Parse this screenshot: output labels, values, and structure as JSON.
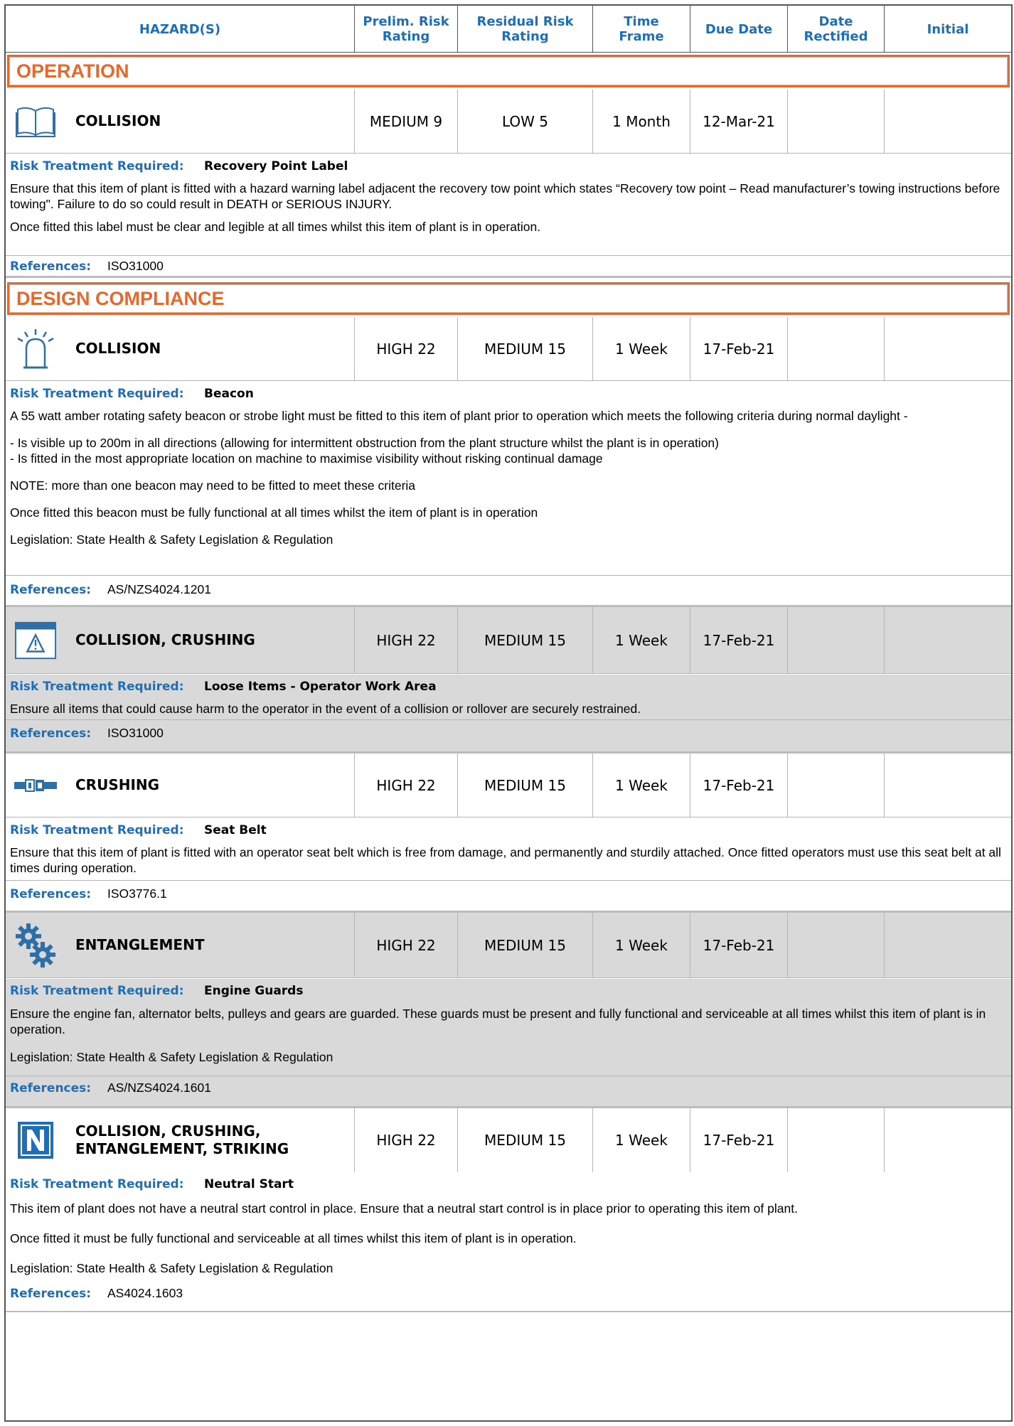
{
  "header": {
    "hazards": "HAZARD(S)",
    "prelim": "Prelim. Risk\nRating",
    "residual": "Residual Risk\nRating",
    "timeframe": "Time\nFrame",
    "due": "Due Date",
    "rectified": "Date\nRectified",
    "initial": "Initial"
  },
  "labels": {
    "risk_treatment": "Risk Treatment Required:",
    "references": "References:"
  },
  "sections": [
    {
      "title": "OPERATION"
    },
    {
      "title": "DESIGN COMPLIANCE"
    }
  ],
  "items": [
    {
      "icon": "open-book-icon",
      "hazard": "COLLISION",
      "prelim": "MEDIUM 9",
      "residual": "LOW 5",
      "timeframe": "1 Month",
      "due": "12-Mar-21",
      "rectified": "",
      "initial": "",
      "treatment": "Recovery Point Label",
      "paragraphs": [
        "Ensure that this item of plant is fitted with a hazard warning label adjacent the recovery tow point which states “Recovery tow point – Read manufacturer’s towing instructions before towing\". Failure to do so could result in DEATH or SERIOUS INJURY.",
        "Once fitted this label must be clear and legible at all times whilst this item of plant is in operation."
      ],
      "references": "ISO31000"
    },
    {
      "icon": "beacon-icon",
      "hazard": "COLLISION",
      "prelim": "HIGH 22",
      "residual": "MEDIUM 15",
      "timeframe": "1 Week",
      "due": "17-Feb-21",
      "rectified": "",
      "initial": "",
      "treatment": "Beacon",
      "paragraphs": [
        "A 55 watt amber rotating safety beacon or strobe light must be fitted to this item of plant prior to operation which meets the following criteria during normal daylight -",
        "- Is visible up to 200m in all directions (allowing for intermittent obstruction from the plant structure whilst the plant is in operation)\n- Is fitted in the most appropriate location on machine to maximise visibility without risking continual damage",
        "NOTE: more than one beacon may need to be fitted to meet these criteria",
        "Once fitted this beacon must be fully functional at all times whilst the item of plant is in operation",
        "Legislation: State Health & Safety Legislation & Regulation"
      ],
      "references": "AS/NZS4024.1201"
    },
    {
      "icon": "warning-window-icon",
      "hazard": "COLLISION, CRUSHING",
      "prelim": "HIGH 22",
      "residual": "MEDIUM 15",
      "timeframe": "1 Week",
      "due": "17-Feb-21",
      "rectified": "",
      "initial": "",
      "treatment": "Loose Items - Operator Work Area",
      "paragraphs": [
        "Ensure all items that could cause harm to the operator in the event of a collision or rollover are securely restrained."
      ],
      "references": "ISO31000"
    },
    {
      "icon": "seat-belt-icon",
      "hazard": "CRUSHING",
      "prelim": "HIGH 22",
      "residual": "MEDIUM 15",
      "timeframe": "1 Week",
      "due": "17-Feb-21",
      "rectified": "",
      "initial": "",
      "treatment": "Seat Belt",
      "paragraphs": [
        "Ensure that this item of plant is fitted with an operator seat belt which is free from damage, and permanently and sturdily attached. Once fitted operators must use this seat belt at all times during operation."
      ],
      "references": "ISO3776.1"
    },
    {
      "icon": "gears-icon",
      "hazard": "ENTANGLEMENT",
      "prelim": "HIGH 22",
      "residual": "MEDIUM 15",
      "timeframe": "1 Week",
      "due": "17-Feb-21",
      "rectified": "",
      "initial": "",
      "treatment": "Engine Guards",
      "paragraphs": [
        "Ensure the engine fan, alternator belts, pulleys and gears are guarded. These guards must be present and fully functional and serviceable at all times whilst this item of plant is in operation.",
        "Legislation: State Health & Safety Legislation & Regulation"
      ],
      "references": "AS/NZS4024.1601"
    },
    {
      "icon": "neutral-n-icon",
      "hazard": "COLLISION, CRUSHING,\nENTANGLEMENT, STRIKING",
      "prelim": "HIGH 22",
      "residual": "MEDIUM 15",
      "timeframe": "1 Week",
      "due": "17-Feb-21",
      "rectified": "",
      "initial": "",
      "treatment": "Neutral Start",
      "paragraphs": [
        "This item of plant does not have a neutral start control in place.  Ensure that a neutral start control is in place prior to operating this item of plant.",
        "Once fitted it must be fully functional and serviceable at all times whilst this item of plant is in operation.",
        "Legislation: State Health & Safety Legislation & Regulation"
      ],
      "references": "AS4024.1603"
    }
  ],
  "colors": {
    "accent_blue": "#1f6eb8",
    "section_orange": "#e8672a",
    "row_grey": "#d9d9d9"
  }
}
